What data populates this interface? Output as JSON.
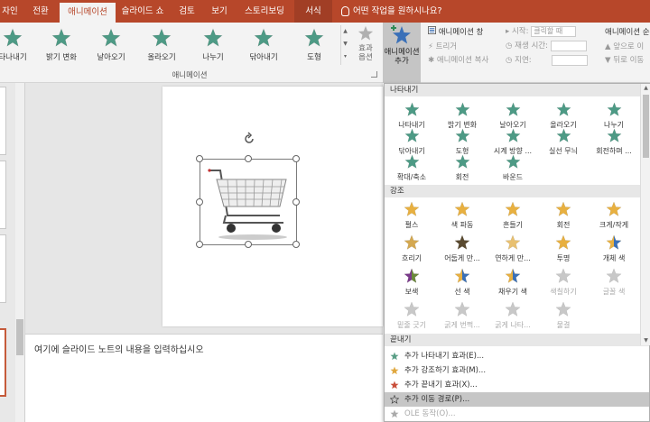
{
  "tabs": [
    {
      "label": "자인",
      "active": false
    },
    {
      "label": "전환",
      "active": false
    },
    {
      "label": "애니메이션",
      "active": true
    },
    {
      "label": "슬라이드 쇼",
      "active": false
    },
    {
      "label": "검토",
      "active": false
    },
    {
      "label": "보기",
      "active": false
    },
    {
      "label": "스토리보딩",
      "active": false
    },
    {
      "label": "서식",
      "active": false
    }
  ],
  "tell_me": "어떤 작업을 원하시나요?",
  "ribbon": {
    "gallery": [
      {
        "label": "타나내기",
        "icon": "appear-star-icon"
      },
      {
        "label": "밝기 변화",
        "icon": "fade-star-icon"
      },
      {
        "label": "날아오기",
        "icon": "fly-in-star-icon"
      },
      {
        "label": "올라오기",
        "icon": "float-in-star-icon"
      },
      {
        "label": "나누기",
        "icon": "split-star-icon"
      },
      {
        "label": "닦아내기",
        "icon": "wipe-star-icon"
      },
      {
        "label": "도형",
        "icon": "shape-star-icon"
      }
    ],
    "effects_options": [
      "효과",
      "옵션"
    ],
    "group_label": "애니메이션",
    "add_animation": [
      "애니메이션",
      "추가"
    ],
    "advanced": {
      "pane": "애니메이션 창",
      "trigger": "트리거",
      "painter": "애니메이션 복사"
    },
    "timing": {
      "start_label": "시작:",
      "start_value": "클릭할 때",
      "duration_label": "재생 시간:",
      "delay_label": "지연:"
    },
    "reorder": {
      "header": "애니메이션 순",
      "earlier": "앞으로 이",
      "later": "뒤로 이동"
    }
  },
  "notes_placeholder": "여기에 슬라이드 노트의 내용을 입력하십시오",
  "dropdown": {
    "sections": {
      "entrance": "나타내기",
      "emphasis": "강조",
      "exit": "끝내기"
    },
    "entrance": [
      "나타내기",
      "밝기 변화",
      "날아오기",
      "올라오기",
      "나누기",
      "닦아내기",
      "도형",
      "시계 방향 ...",
      "실선 무늬",
      "회전하며 ...",
      "확대/축소",
      "회전",
      "바운드"
    ],
    "emphasis": [
      "펄스",
      "색 파동",
      "흔들기",
      "회전",
      "크게/작게",
      "흐리기",
      "어둡게 만...",
      "연하게 만...",
      "투명",
      "개체 색",
      "보색",
      "선 색",
      "채우기 색",
      "색칠하기",
      "글꼴 색",
      "밑줄 긋기",
      "굵게 번쩍...",
      "굵게 나타...",
      "물결"
    ],
    "more": [
      {
        "label": "추가 나타내기 효과(E)...",
        "icon": "green-star-icon",
        "color": "#5a9e86"
      },
      {
        "label": "추가 강조하기 효과(M)...",
        "icon": "gold-star-icon",
        "color": "#e0a840"
      },
      {
        "label": "추가 끝내기 효과(X)...",
        "icon": "red-star-icon",
        "color": "#c94e3a"
      },
      {
        "label": "추가 이동 경로(P)...",
        "icon": "outline-star-icon",
        "color": "#555555"
      },
      {
        "label": "OLE 동작(O)...",
        "icon": "ole-action-icon",
        "color": "#aaaaaa"
      }
    ]
  }
}
